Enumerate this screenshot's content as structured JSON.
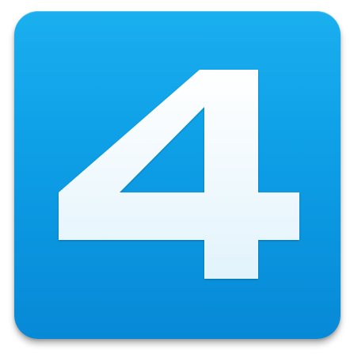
{
  "app_icon": {
    "glyph": "4",
    "icon_name": "four-icon",
    "colors": {
      "tile_top": "#1aafef",
      "tile_bottom": "#0789d6",
      "glyph_top": "#ffffff",
      "glyph_bottom": "#e2f3fc"
    }
  }
}
